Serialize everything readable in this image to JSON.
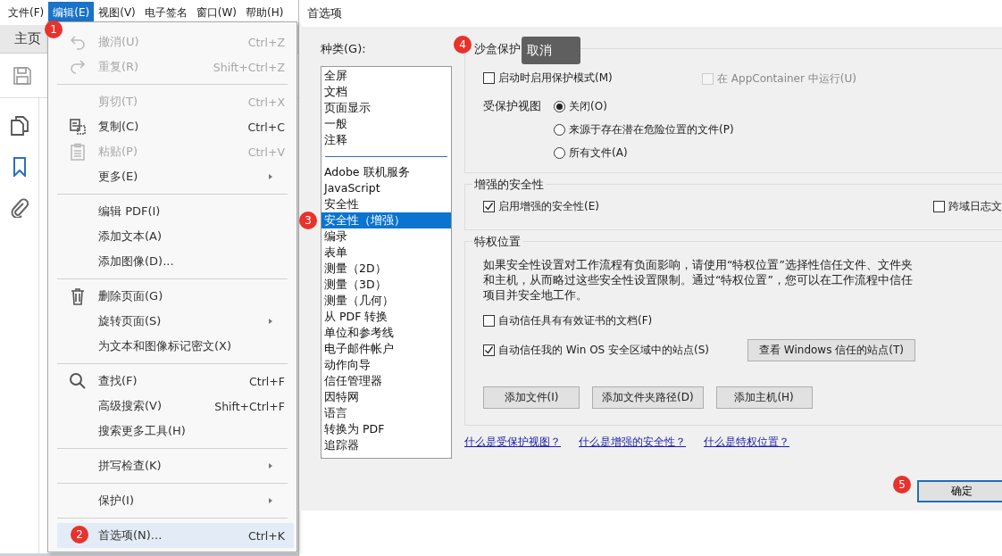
{
  "menubar": [
    {
      "label": "文件(F)",
      "selected": false
    },
    {
      "label": "编辑(E)",
      "selected": true
    },
    {
      "label": "视图(V)",
      "selected": false
    },
    {
      "label": "电子签名",
      "selected": false
    },
    {
      "label": "窗口(W)",
      "selected": false
    },
    {
      "label": "帮助(H)",
      "selected": false
    }
  ],
  "app": {
    "tab": "主页"
  },
  "edit_menu": [
    {
      "kind": "item",
      "label": "撤消(U)",
      "shortcut": "Ctrl+Z",
      "disabled": true,
      "submenu": false,
      "selected": false
    },
    {
      "kind": "item",
      "label": "重复(R)",
      "shortcut": "Shift+Ctrl+Z",
      "disabled": true,
      "submenu": false,
      "selected": false
    },
    {
      "kind": "separator"
    },
    {
      "kind": "item",
      "label": "剪切(T)",
      "shortcut": "Ctrl+X",
      "disabled": true,
      "submenu": false,
      "selected": false
    },
    {
      "kind": "item",
      "label": "复制(C)",
      "shortcut": "Ctrl+C",
      "disabled": false,
      "submenu": false,
      "selected": false
    },
    {
      "kind": "item",
      "label": "粘贴(P)",
      "shortcut": "Ctrl+V",
      "disabled": true,
      "submenu": false,
      "selected": false
    },
    {
      "kind": "item",
      "label": "更多(E)",
      "disabled": false,
      "submenu": true,
      "selected": false
    },
    {
      "kind": "separator"
    },
    {
      "kind": "item",
      "label": "编辑 PDF(I)",
      "disabled": false,
      "submenu": false,
      "selected": false
    },
    {
      "kind": "item",
      "label": "添加文本(A)",
      "disabled": false,
      "submenu": false,
      "selected": false
    },
    {
      "kind": "item",
      "label": "添加图像(D)...",
      "disabled": false,
      "submenu": false,
      "selected": false
    },
    {
      "kind": "separator"
    },
    {
      "kind": "item",
      "label": "删除页面(G)",
      "disabled": false,
      "submenu": false,
      "selected": false
    },
    {
      "kind": "item",
      "label": "旋转页面(S)",
      "disabled": false,
      "submenu": true,
      "selected": false
    },
    {
      "kind": "item",
      "label": "为文本和图像标记密文(X)",
      "disabled": false,
      "submenu": false,
      "selected": false
    },
    {
      "kind": "separator"
    },
    {
      "kind": "item",
      "label": "查找(F)",
      "shortcut": "Ctrl+F",
      "disabled": false,
      "submenu": false,
      "selected": false
    },
    {
      "kind": "item",
      "label": "高级搜索(V)",
      "shortcut": "Shift+Ctrl+F",
      "disabled": false,
      "submenu": false,
      "selected": false
    },
    {
      "kind": "item",
      "label": "搜索更多工具(H)",
      "disabled": false,
      "submenu": false,
      "selected": false
    },
    {
      "kind": "separator"
    },
    {
      "kind": "item",
      "label": "拼写检查(K)",
      "disabled": false,
      "submenu": true,
      "selected": false
    },
    {
      "kind": "separator"
    },
    {
      "kind": "item",
      "label": "保护(I)",
      "disabled": false,
      "submenu": true,
      "selected": false
    },
    {
      "kind": "separator"
    },
    {
      "kind": "item",
      "label": "首选项(N)...",
      "shortcut": "Ctrl+K",
      "disabled": false,
      "submenu": false,
      "selected": true
    }
  ],
  "dialog": {
    "title": "首选项",
    "category_label": "种类(G):",
    "categories": [
      {
        "kind": "item",
        "label": "全屏",
        "selected": false
      },
      {
        "kind": "item",
        "label": "文档",
        "selected": false
      },
      {
        "kind": "item",
        "label": "页面显示",
        "selected": false
      },
      {
        "kind": "item",
        "label": "一般",
        "selected": false
      },
      {
        "kind": "item",
        "label": "注释",
        "selected": false
      },
      {
        "kind": "separator"
      },
      {
        "kind": "item",
        "label": "Adobe 联机服务",
        "selected": false
      },
      {
        "kind": "item",
        "label": "JavaScript",
        "selected": false
      },
      {
        "kind": "item",
        "label": "安全性",
        "selected": false
      },
      {
        "kind": "item",
        "label": "安全性（增强）",
        "selected": true
      },
      {
        "kind": "item",
        "label": "编录",
        "selected": false
      },
      {
        "kind": "item",
        "label": "表单",
        "selected": false
      },
      {
        "kind": "item",
        "label": "测量（2D）",
        "selected": false
      },
      {
        "kind": "item",
        "label": "测量（3D）",
        "selected": false
      },
      {
        "kind": "item",
        "label": "测量（几何）",
        "selected": false
      },
      {
        "kind": "item",
        "label": "从 PDF 转换",
        "selected": false
      },
      {
        "kind": "item",
        "label": "单位和参考线",
        "selected": false
      },
      {
        "kind": "item",
        "label": "电子邮件帐户",
        "selected": false
      },
      {
        "kind": "item",
        "label": "动作向导",
        "selected": false
      },
      {
        "kind": "item",
        "label": "信任管理器",
        "selected": false
      },
      {
        "kind": "item",
        "label": "因特网",
        "selected": false
      },
      {
        "kind": "item",
        "label": "语言",
        "selected": false
      },
      {
        "kind": "item",
        "label": "转换为 PDF",
        "selected": false
      },
      {
        "kind": "item",
        "label": "追踪器",
        "selected": false
      }
    ],
    "sandbox": {
      "title": "沙盒保护",
      "protected_mode": {
        "label": "启动时启用保护模式(M)",
        "checked": false,
        "disabled": false
      },
      "app_container": {
        "label": "在 AppContainer 中运行(U)",
        "checked": false,
        "disabled": true
      },
      "protected_view_label": "受保护视图",
      "protected_view": [
        {
          "label": "关闭(O)",
          "selected": true
        },
        {
          "label": "来源于存在潜在危险位置的文件(P)",
          "selected": false
        },
        {
          "label": "所有文件(A)",
          "selected": false
        }
      ]
    },
    "enhanced": {
      "title": "增强的安全性",
      "enable": {
        "label": "启用增强的安全性(E)",
        "checked": true,
        "disabled": false
      },
      "cross_domain": {
        "label": "跨域日志文",
        "checked": false,
        "disabled": false
      }
    },
    "privileged": {
      "title": "特权位置",
      "description": [
        "如果安全性设置对工作流程有负面影响，请使用“特权位置”选择性信任文件、文件夹",
        "和主机，从而略过这些安全性设置限制。通过“特权位置”，您可以在工作流程中信任",
        "项目并安全地工作。"
      ],
      "trust_certified": {
        "label": "自动信任具有有效证书的文档(F)",
        "checked": false,
        "disabled": false
      },
      "trust_win_os": {
        "label": "自动信任我的 Win OS 安全区域中的站点(S)",
        "checked": true,
        "disabled": false
      },
      "view_sites_button": "查看 Windows 信任的站点(T)",
      "buttons": [
        "添加文件(I)",
        "添加文件夹路径(D)",
        "添加主机(H)"
      ]
    },
    "links": [
      "什么是受保护视图？",
      "什么是增强的安全性？",
      "什么是特权位置？"
    ],
    "ok_button": "确定",
    "tooltip": "取消"
  },
  "annotations": [
    "1",
    "2",
    "3",
    "4",
    "5"
  ]
}
